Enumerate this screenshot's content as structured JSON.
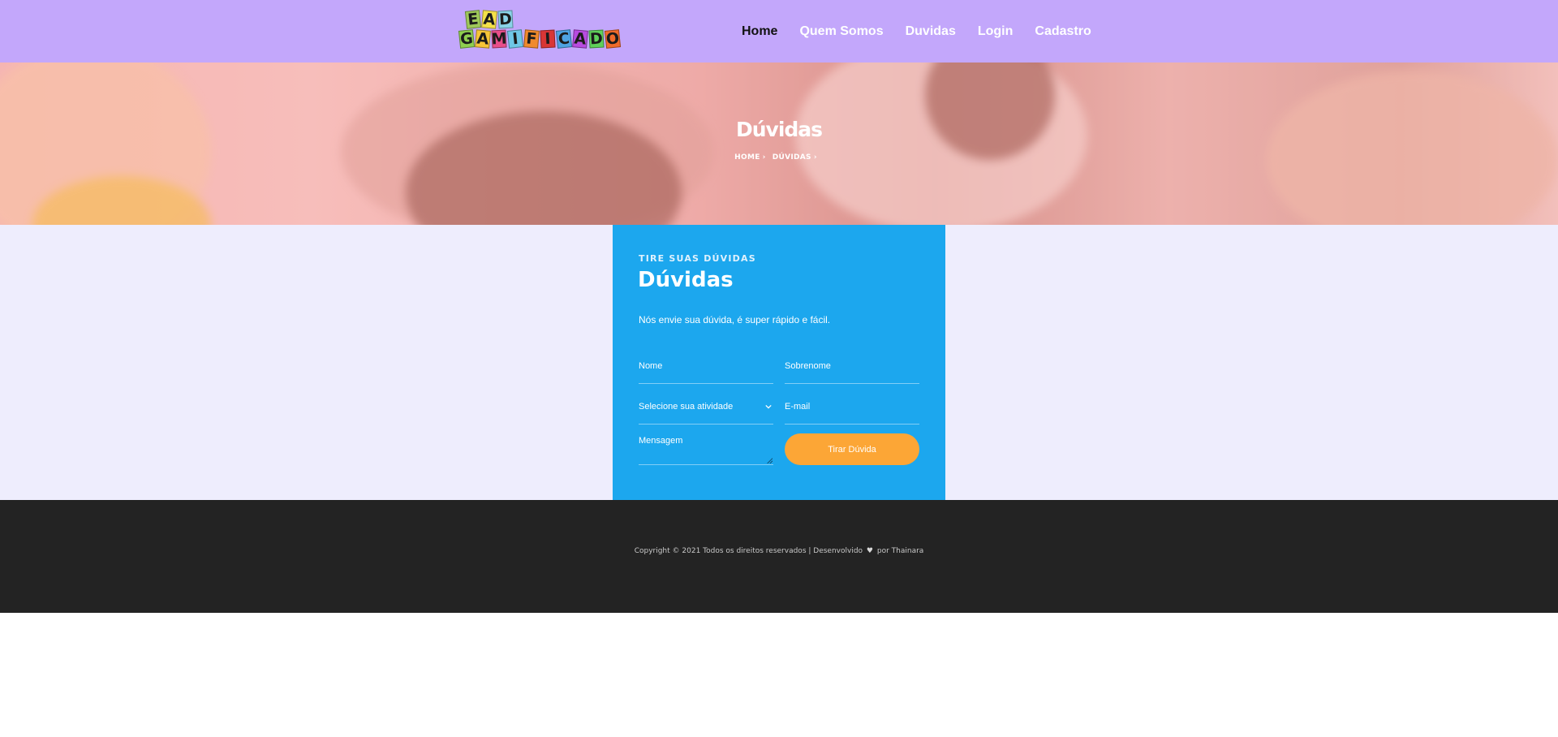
{
  "header": {
    "logo": {
      "row1": [
        {
          "letter": "E",
          "color": "#9fc95a"
        },
        {
          "letter": "A",
          "color": "#f4e14a"
        },
        {
          "letter": "D",
          "color": "#8ad3e8"
        }
      ],
      "row2": [
        {
          "letter": "G",
          "color": "#8fcf4f"
        },
        {
          "letter": "A",
          "color": "#f6c437"
        },
        {
          "letter": "M",
          "color": "#e84e8a"
        },
        {
          "letter": "I",
          "color": "#6ec7e6"
        },
        {
          "letter": "F",
          "color": "#f08a2c"
        },
        {
          "letter": "I",
          "color": "#d93636"
        },
        {
          "letter": "C",
          "color": "#4ea3e3"
        },
        {
          "letter": "A",
          "color": "#b84be0"
        },
        {
          "letter": "D",
          "color": "#5fd05a"
        },
        {
          "letter": "O",
          "color": "#f06b2a"
        }
      ]
    },
    "nav": [
      {
        "label": "Home",
        "active": true
      },
      {
        "label": "Quem Somos",
        "active": false
      },
      {
        "label": "Duvidas",
        "active": false
      },
      {
        "label": "Login",
        "active": false
      },
      {
        "label": "Cadastro",
        "active": false
      }
    ],
    "background": "#c3a7fb"
  },
  "hero": {
    "title": "Dúvidas",
    "breadcrumb": [
      "HOME",
      "DÚVIDAS"
    ]
  },
  "form_card": {
    "eyebrow": "TIRE SUAS DÚVIDAS",
    "title": "Dúvidas",
    "description": "Nós envie sua dúvida, é super rápido e fácil.",
    "fields": {
      "nome": {
        "placeholder": "Nome",
        "value": ""
      },
      "sobrenome": {
        "placeholder": "Sobrenome",
        "value": ""
      },
      "atividade": {
        "selected": "Selecione sua atividade"
      },
      "email": {
        "placeholder": "E-mail",
        "value": ""
      },
      "mensagem": {
        "placeholder": "Mensagem",
        "value": ""
      }
    },
    "submit_label": "Tirar Dúvida",
    "background": "#1ca7ee",
    "button_color": "#fca636"
  },
  "footer": {
    "copyright": "Copyright © 2021 Todos os direitos reservados | Desenvolvido",
    "heart_icon": "heart-icon",
    "by": "por Thainara"
  },
  "colors": {
    "page_background": "#eeedfd",
    "footer_background": "#232323"
  }
}
